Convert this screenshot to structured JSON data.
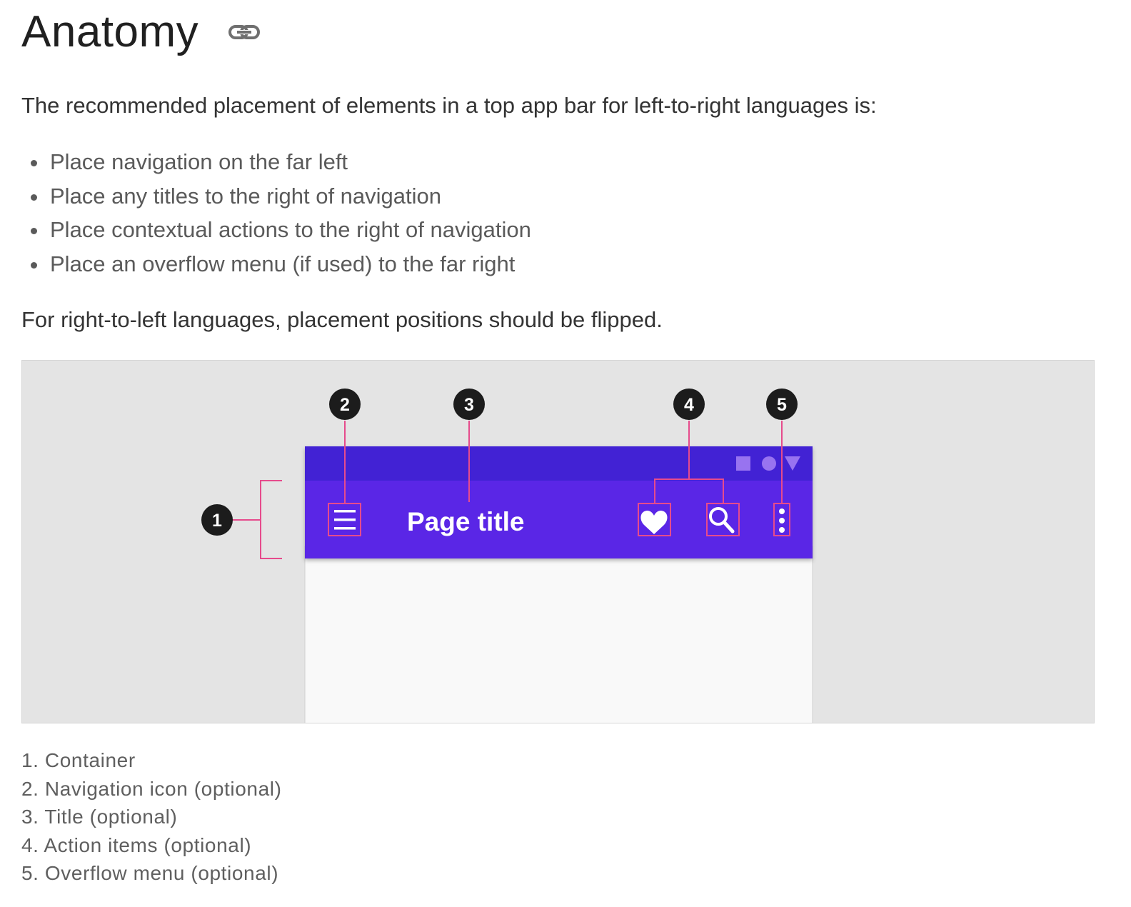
{
  "heading": "Anatomy",
  "intro": "The recommended placement of elements in a top app bar for left-to-right languages is:",
  "bullets": [
    "Place navigation on the far left",
    "Place any titles to the right of navigation",
    "Place contextual actions to the right of navigation",
    "Place an overflow menu (if used) to the far right"
  ],
  "rtl_note": "For right-to-left languages, placement positions should be flipped.",
  "figure": {
    "app_bar_title": "Page title",
    "callouts": [
      "1",
      "2",
      "3",
      "4",
      "5"
    ],
    "colors": {
      "status_bar": "#4321d4",
      "app_bar": "#5a28e6",
      "callout_line": "#e64b8c",
      "callout_badge": "#1c1c1c",
      "background": "#e4e4e4",
      "content": "#f9f9f9"
    },
    "icons": [
      "link-icon",
      "menu-icon",
      "heart-icon",
      "search-icon",
      "more-vert-icon",
      "square-icon",
      "circle-icon",
      "triangle-icon"
    ]
  },
  "captions": [
    "1. Container",
    "2. Navigation icon (optional)",
    "3. Title (optional)",
    "4. Action items (optional)",
    "5. Overflow menu (optional)"
  ]
}
